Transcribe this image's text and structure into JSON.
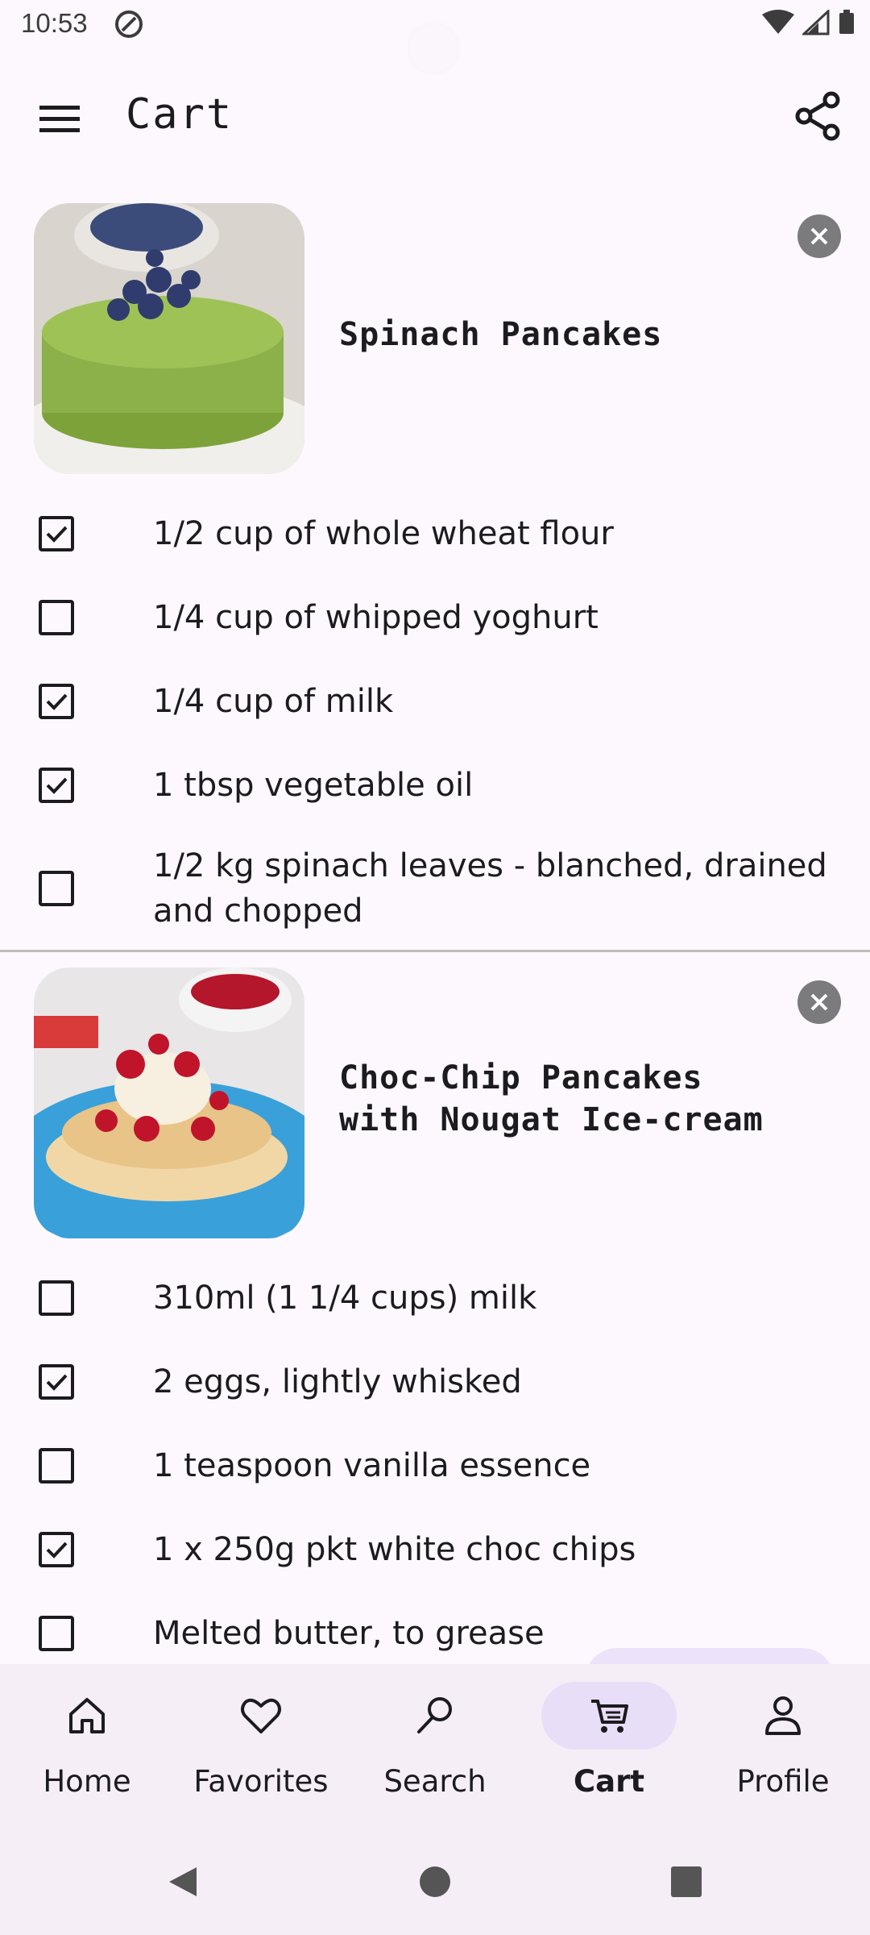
{
  "status_bar": {
    "time": "10:53"
  },
  "app_bar": {
    "title": "Cart",
    "menu_icon": "menu-icon",
    "share_icon": "share-icon"
  },
  "recipes": [
    {
      "title_lines": [
        "Spinach Pancakes"
      ],
      "image_alt": "spinach pancakes with blueberries",
      "ingredients": [
        {
          "text": "1/2 cup of whole wheat flour",
          "checked": true
        },
        {
          "text": "1/4 cup of whipped yoghurt",
          "checked": false
        },
        {
          "text": "1/4 cup of milk",
          "checked": true
        },
        {
          "text": "1 tbsp vegetable oil",
          "checked": true
        },
        {
          "text": "1/2 kg spinach leaves - blanched, drained and chopped",
          "checked": false
        }
      ]
    },
    {
      "title_lines": [
        "Choc-Chip Pancakes",
        "with Nougat Ice-cream"
      ],
      "image_alt": "pancakes with ice-cream and raspberry sauce",
      "ingredients": [
        {
          "text": "310ml (1 1/4 cups) milk",
          "checked": false
        },
        {
          "text": "2 eggs, lightly whisked",
          "checked": true
        },
        {
          "text": "1 teaspoon vanilla essence",
          "checked": false
        },
        {
          "text": "1 x 250g pkt white choc chips",
          "checked": true
        },
        {
          "text": "Melted butter, to grease",
          "checked": false
        }
      ]
    }
  ],
  "bottom_nav": {
    "items": [
      {
        "label": "Home",
        "icon": "home-icon",
        "active": false
      },
      {
        "label": "Favorites",
        "icon": "heart-icon",
        "active": false
      },
      {
        "label": "Search",
        "icon": "search-icon",
        "active": false
      },
      {
        "label": "Cart",
        "icon": "cart-icon",
        "active": true
      },
      {
        "label": "Profile",
        "icon": "person-icon",
        "active": false
      }
    ]
  },
  "colors": {
    "background": "#fdf8fd",
    "nav_active_pill": "#e8def8",
    "remove_button": "#7b7b7e"
  }
}
